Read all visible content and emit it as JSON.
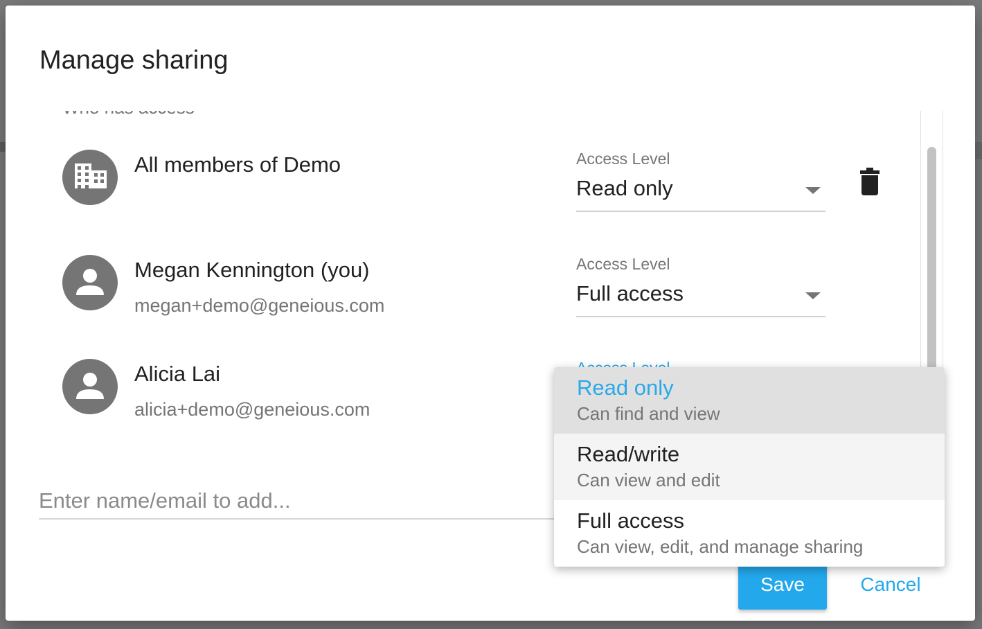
{
  "dialog": {
    "title": "Manage sharing",
    "section_heading": "Who has access"
  },
  "members": [
    {
      "name": "All members of Demo",
      "email": "",
      "avatar_icon": "building-icon",
      "access_label": "Access Level",
      "access_value": "Read only",
      "removable": true
    },
    {
      "name": "Megan Kennington (you)",
      "email": "megan+demo@geneious.com",
      "avatar_icon": "person-icon",
      "access_label": "Access Level",
      "access_value": "Full access"
    },
    {
      "name": "Alicia Lai",
      "email": "alicia+demo@geneious.com",
      "avatar_icon": "person-icon",
      "access_label": "Access Level"
    }
  ],
  "add_input": {
    "placeholder": "Enter name/email to add..."
  },
  "access_menu": {
    "options": [
      {
        "label": "Read only",
        "description": "Can find and view",
        "selected": true
      },
      {
        "label": "Read/write",
        "description": "Can view and edit",
        "hovered": true
      },
      {
        "label": "Full access",
        "description": "Can view, edit, and manage sharing"
      }
    ]
  },
  "actions": {
    "save_label": "Save",
    "cancel_label": "Cancel"
  },
  "colors": {
    "accent": "#24a8ec",
    "text_primary": "#212121",
    "text_secondary": "#757575",
    "avatar_bg": "#757575"
  },
  "icons": {
    "remove": "trash-icon",
    "dropdown": "chevron-down-icon"
  }
}
